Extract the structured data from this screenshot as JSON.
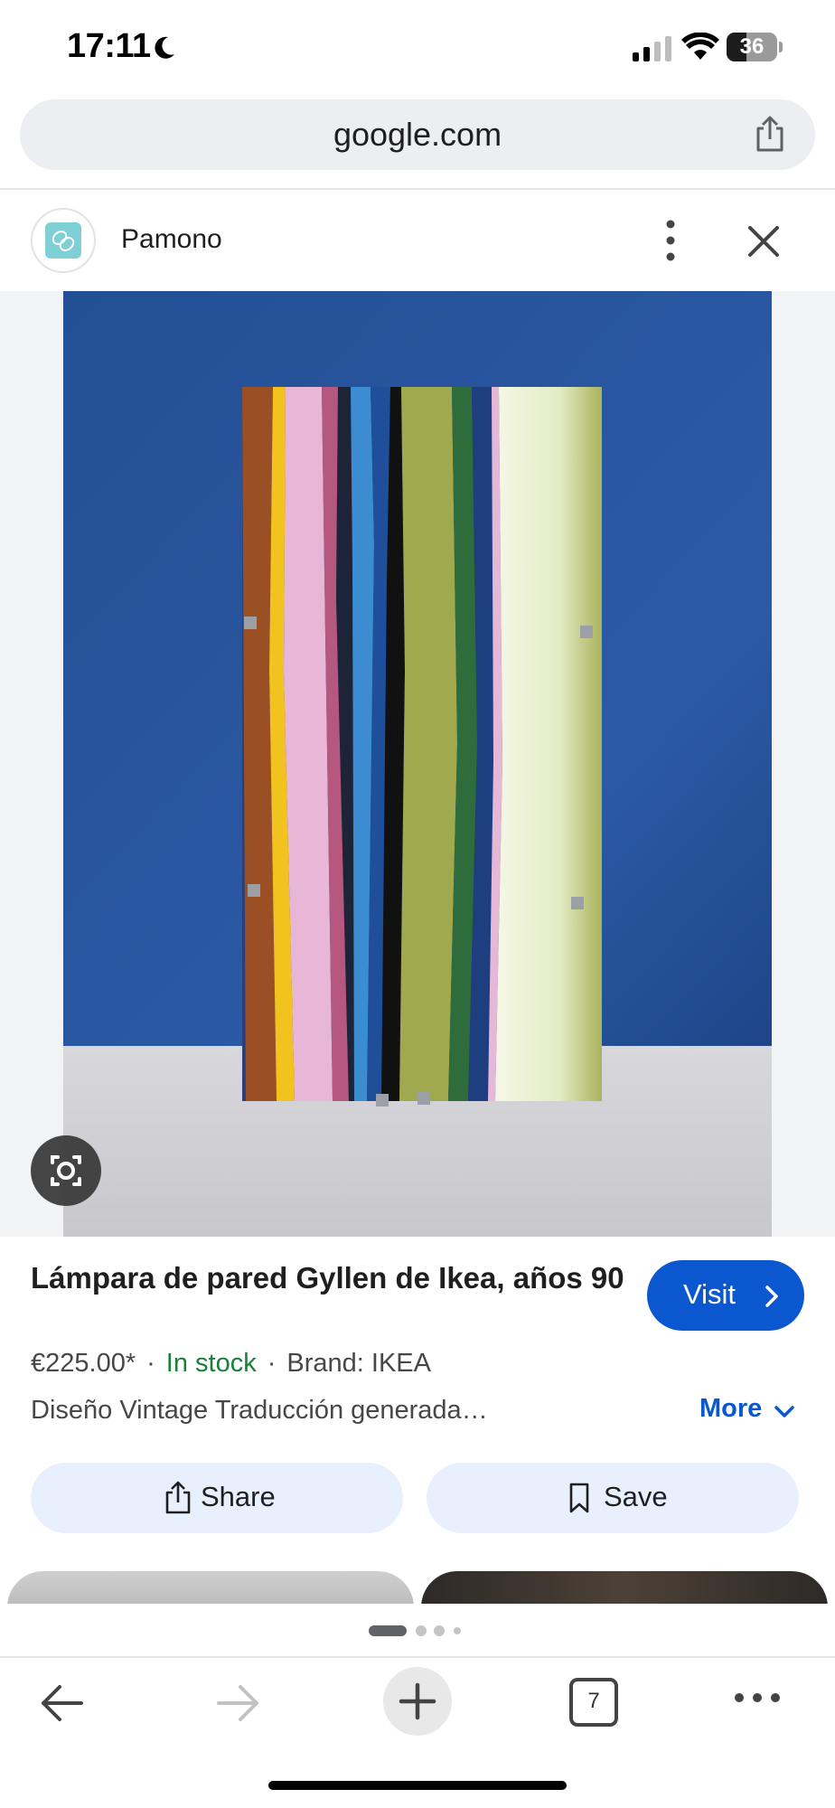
{
  "status_bar": {
    "time": "17:11",
    "battery_level": "36"
  },
  "browser": {
    "url": "google.com",
    "tab_count": "7"
  },
  "source": {
    "name": "Pamono"
  },
  "image": {
    "description_icon": "photo-of-striped-glass-wall-lamp"
  },
  "product": {
    "title": "Lámpara de pared Gyllen de Ikea, años 90",
    "price": "€225.00*",
    "separator": "·",
    "stock": "In stock",
    "brand": "Brand: IKEA",
    "description": "Diseño Vintage Traducción generada…",
    "more_label": "More",
    "visit_label": "Visit"
  },
  "actions": {
    "share_label": "Share",
    "save_label": "Save"
  },
  "colors": {
    "accent_blue": "#0b57d0",
    "stock_green": "#188038",
    "action_bg": "#e8f0fe"
  }
}
